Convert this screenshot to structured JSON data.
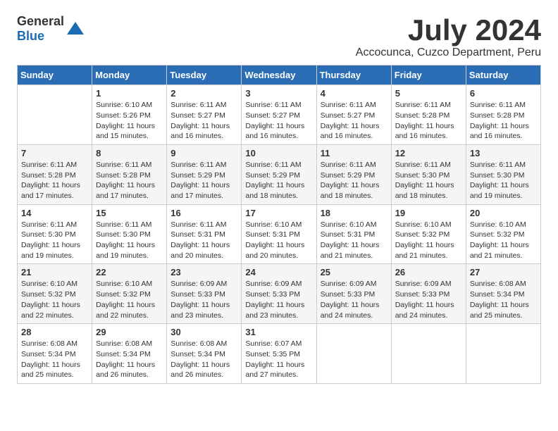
{
  "header": {
    "logo_general": "General",
    "logo_blue": "Blue",
    "month_title": "July 2024",
    "location": "Accocunca, Cuzco Department, Peru"
  },
  "calendar": {
    "days_of_week": [
      "Sunday",
      "Monday",
      "Tuesday",
      "Wednesday",
      "Thursday",
      "Friday",
      "Saturday"
    ],
    "weeks": [
      [
        {
          "day": "",
          "info": ""
        },
        {
          "day": "1",
          "info": "Sunrise: 6:10 AM\nSunset: 5:26 PM\nDaylight: 11 hours\nand 15 minutes."
        },
        {
          "day": "2",
          "info": "Sunrise: 6:11 AM\nSunset: 5:27 PM\nDaylight: 11 hours\nand 16 minutes."
        },
        {
          "day": "3",
          "info": "Sunrise: 6:11 AM\nSunset: 5:27 PM\nDaylight: 11 hours\nand 16 minutes."
        },
        {
          "day": "4",
          "info": "Sunrise: 6:11 AM\nSunset: 5:27 PM\nDaylight: 11 hours\nand 16 minutes."
        },
        {
          "day": "5",
          "info": "Sunrise: 6:11 AM\nSunset: 5:28 PM\nDaylight: 11 hours\nand 16 minutes."
        },
        {
          "day": "6",
          "info": "Sunrise: 6:11 AM\nSunset: 5:28 PM\nDaylight: 11 hours\nand 16 minutes."
        }
      ],
      [
        {
          "day": "7",
          "info": "Sunrise: 6:11 AM\nSunset: 5:28 PM\nDaylight: 11 hours\nand 17 minutes."
        },
        {
          "day": "8",
          "info": "Sunrise: 6:11 AM\nSunset: 5:28 PM\nDaylight: 11 hours\nand 17 minutes."
        },
        {
          "day": "9",
          "info": "Sunrise: 6:11 AM\nSunset: 5:29 PM\nDaylight: 11 hours\nand 17 minutes."
        },
        {
          "day": "10",
          "info": "Sunrise: 6:11 AM\nSunset: 5:29 PM\nDaylight: 11 hours\nand 18 minutes."
        },
        {
          "day": "11",
          "info": "Sunrise: 6:11 AM\nSunset: 5:29 PM\nDaylight: 11 hours\nand 18 minutes."
        },
        {
          "day": "12",
          "info": "Sunrise: 6:11 AM\nSunset: 5:30 PM\nDaylight: 11 hours\nand 18 minutes."
        },
        {
          "day": "13",
          "info": "Sunrise: 6:11 AM\nSunset: 5:30 PM\nDaylight: 11 hours\nand 19 minutes."
        }
      ],
      [
        {
          "day": "14",
          "info": "Sunrise: 6:11 AM\nSunset: 5:30 PM\nDaylight: 11 hours\nand 19 minutes."
        },
        {
          "day": "15",
          "info": "Sunrise: 6:11 AM\nSunset: 5:30 PM\nDaylight: 11 hours\nand 19 minutes."
        },
        {
          "day": "16",
          "info": "Sunrise: 6:11 AM\nSunset: 5:31 PM\nDaylight: 11 hours\nand 20 minutes."
        },
        {
          "day": "17",
          "info": "Sunrise: 6:10 AM\nSunset: 5:31 PM\nDaylight: 11 hours\nand 20 minutes."
        },
        {
          "day": "18",
          "info": "Sunrise: 6:10 AM\nSunset: 5:31 PM\nDaylight: 11 hours\nand 21 minutes."
        },
        {
          "day": "19",
          "info": "Sunrise: 6:10 AM\nSunset: 5:32 PM\nDaylight: 11 hours\nand 21 minutes."
        },
        {
          "day": "20",
          "info": "Sunrise: 6:10 AM\nSunset: 5:32 PM\nDaylight: 11 hours\nand 21 minutes."
        }
      ],
      [
        {
          "day": "21",
          "info": "Sunrise: 6:10 AM\nSunset: 5:32 PM\nDaylight: 11 hours\nand 22 minutes."
        },
        {
          "day": "22",
          "info": "Sunrise: 6:10 AM\nSunset: 5:32 PM\nDaylight: 11 hours\nand 22 minutes."
        },
        {
          "day": "23",
          "info": "Sunrise: 6:09 AM\nSunset: 5:33 PM\nDaylight: 11 hours\nand 23 minutes."
        },
        {
          "day": "24",
          "info": "Sunrise: 6:09 AM\nSunset: 5:33 PM\nDaylight: 11 hours\nand 23 minutes."
        },
        {
          "day": "25",
          "info": "Sunrise: 6:09 AM\nSunset: 5:33 PM\nDaylight: 11 hours\nand 24 minutes."
        },
        {
          "day": "26",
          "info": "Sunrise: 6:09 AM\nSunset: 5:33 PM\nDaylight: 11 hours\nand 24 minutes."
        },
        {
          "day": "27",
          "info": "Sunrise: 6:08 AM\nSunset: 5:34 PM\nDaylight: 11 hours\nand 25 minutes."
        }
      ],
      [
        {
          "day": "28",
          "info": "Sunrise: 6:08 AM\nSunset: 5:34 PM\nDaylight: 11 hours\nand 25 minutes."
        },
        {
          "day": "29",
          "info": "Sunrise: 6:08 AM\nSunset: 5:34 PM\nDaylight: 11 hours\nand 26 minutes."
        },
        {
          "day": "30",
          "info": "Sunrise: 6:08 AM\nSunset: 5:34 PM\nDaylight: 11 hours\nand 26 minutes."
        },
        {
          "day": "31",
          "info": "Sunrise: 6:07 AM\nSunset: 5:35 PM\nDaylight: 11 hours\nand 27 minutes."
        },
        {
          "day": "",
          "info": ""
        },
        {
          "day": "",
          "info": ""
        },
        {
          "day": "",
          "info": ""
        }
      ]
    ]
  }
}
